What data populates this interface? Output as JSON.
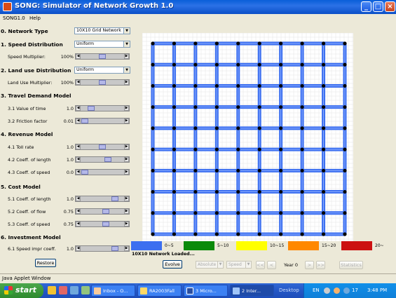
{
  "window": {
    "title": "SONG: Simulator of Network Growth 1.0"
  },
  "menu": [
    "SONG1.0",
    "Help"
  ],
  "sections": {
    "network_type": "0. Network Type",
    "speed_distribution": "1. Speed Distribution",
    "land_use": "2. Land use Distribution",
    "travel_demand": "3. Travel Demand Model",
    "revenue": "4. Revenue Model",
    "cost": "5. Cost Model",
    "investment": "6. Investment Model"
  },
  "combos": {
    "network_type": "10X10 Grid Network",
    "speed_distribution": "Uniform",
    "land_use": "Uniform"
  },
  "params": [
    {
      "label": "Speed Multiplier:",
      "value": "100%",
      "level": 0.5
    },
    {
      "label": "Land Use Multiplier:",
      "value": "100%",
      "level": 0.5
    },
    {
      "label": "3.1 Value of time",
      "value": "1.0",
      "level": 0.2
    },
    {
      "label": "3.2 Friction factor",
      "value": "0.01",
      "level": 0.02
    },
    {
      "label": "4.1 Toll rate",
      "value": "1.0",
      "level": 0.5
    },
    {
      "label": "4.2 Coeff. of length",
      "value": "1.0",
      "level": 0.65
    },
    {
      "label": "4.3 Coeff. of speed",
      "value": "0.0",
      "level": 0.02
    },
    {
      "label": "5.1 Coeff. of length",
      "value": "1.0",
      "level": 0.85
    },
    {
      "label": "5.2 Coeff. of flow",
      "value": "0.75",
      "level": 0.6
    },
    {
      "label": "5.3 Coeff. of speed",
      "value": "0.75",
      "level": 0.6
    },
    {
      "label": "6.1 Speed impr coeff.",
      "value": "1.0",
      "level": 0.85
    }
  ],
  "buttons": {
    "restore": "Restore",
    "evolve": "Evolve",
    "statistics": "Statistics",
    "back_back": "<<",
    "back": "<",
    "fwd": ">",
    "fwd_fwd": ">>"
  },
  "controls": {
    "absolute": "Absolute",
    "speed": "Speed",
    "year": "Year 0"
  },
  "legend": [
    {
      "label": "0~5",
      "color": "#3c6ff0"
    },
    {
      "label": "5~10",
      "color": "#0a8a0a"
    },
    {
      "label": "10~15",
      "color": "#ffff00"
    },
    {
      "label": "15~20",
      "color": "#ff8800"
    },
    {
      "label": "20~",
      "color": "#cc1111"
    }
  ],
  "status": "10X10 Network Loaded...",
  "java_window": "Java Applet Window",
  "taskbar": {
    "start": "start",
    "tasks": [
      "Inbox - O...",
      "RA2003Fall",
      "3 Micro...",
      "2 Inter..."
    ],
    "desktop": "Desktop",
    "lang": "EN",
    "temp": "17",
    "clock": "3:48 PM"
  },
  "grid": {
    "rows": 10,
    "cols": 10,
    "link_color": "#3c6ff0",
    "node_color": "#000000"
  }
}
